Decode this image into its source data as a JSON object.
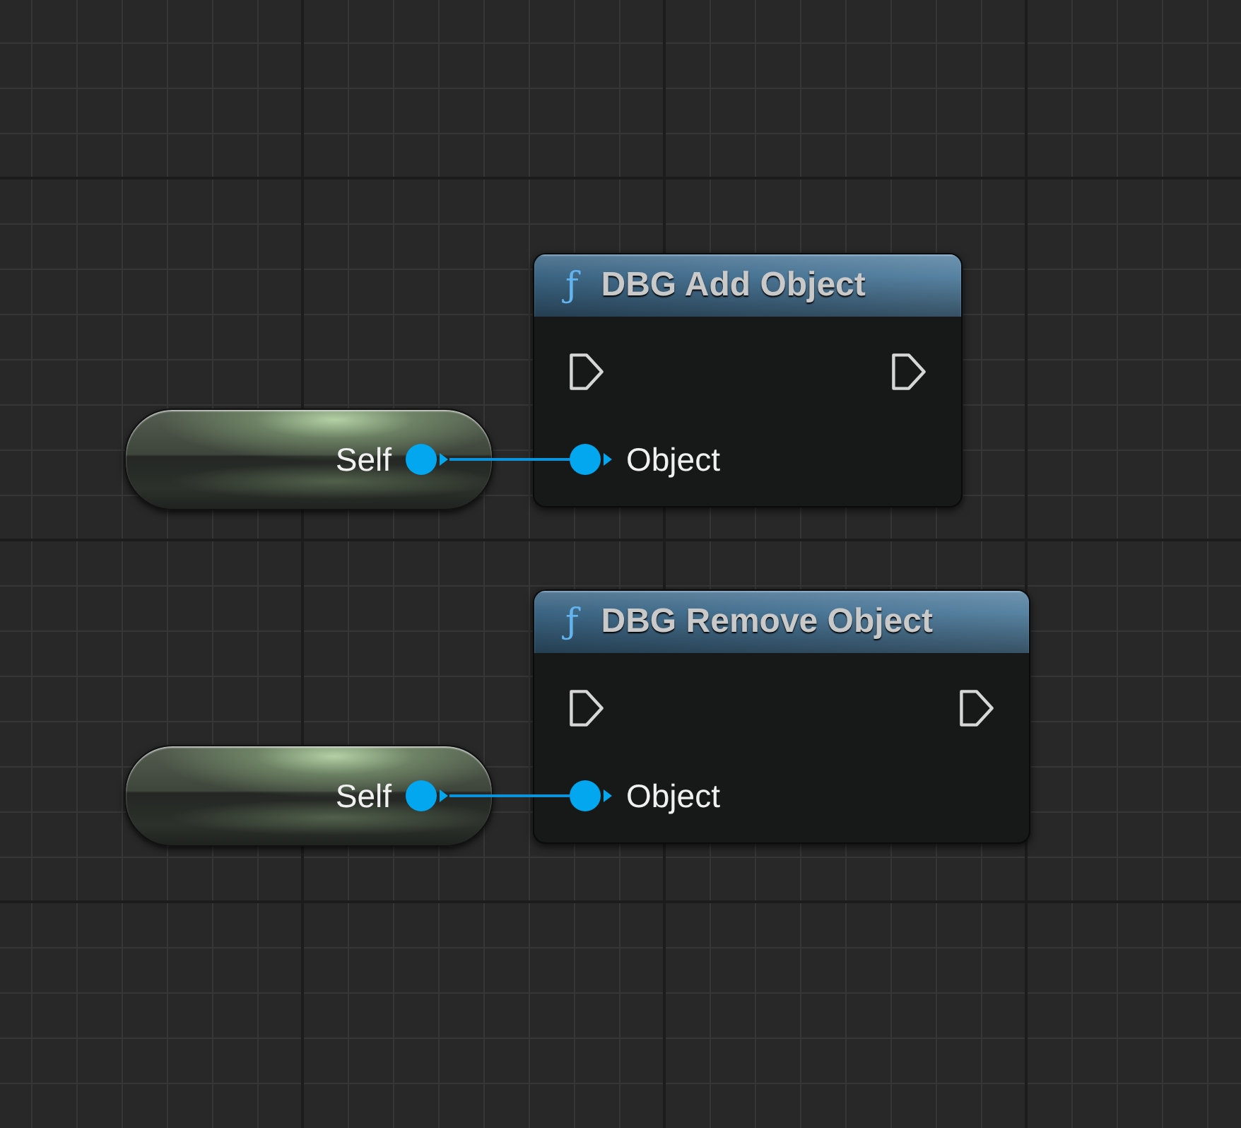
{
  "graph": {
    "rows": [
      {
        "source_node": {
          "label": "Self",
          "pin_connected": true
        },
        "function_node": {
          "icon": "ƒ",
          "title": "DBG Add Object",
          "exec_in": {
            "connected": false
          },
          "exec_out": {
            "connected": false
          },
          "input_pin": {
            "label": "Object",
            "connected": true
          }
        }
      },
      {
        "source_node": {
          "label": "Self",
          "pin_connected": true
        },
        "function_node": {
          "icon": "ƒ",
          "title": "DBG Remove Object",
          "exec_in": {
            "connected": false
          },
          "exec_out": {
            "connected": false
          },
          "input_pin": {
            "label": "Object",
            "connected": true
          }
        }
      }
    ]
  }
}
